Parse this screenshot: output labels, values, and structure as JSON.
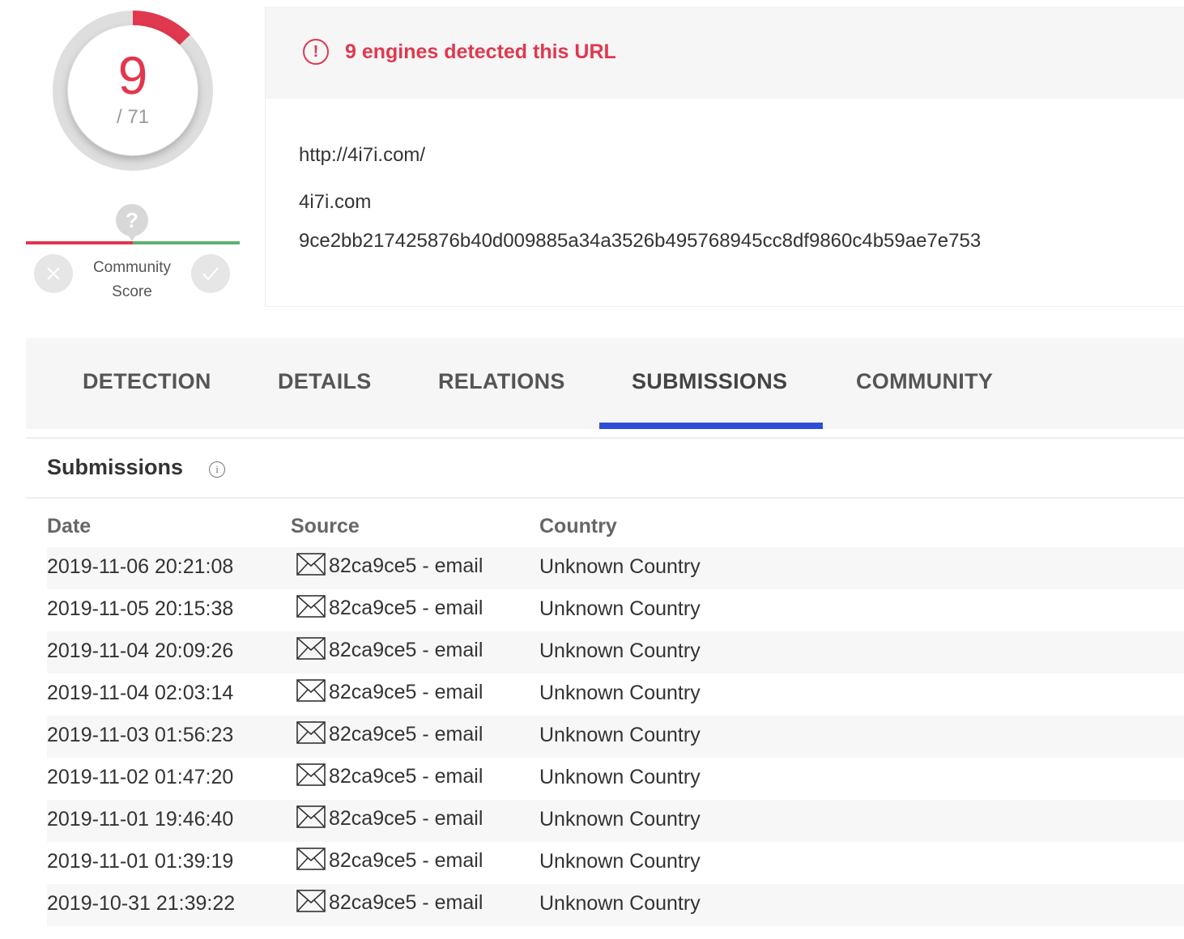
{
  "score": {
    "detected": "9",
    "total": "/ 71",
    "ratio": 0.1268,
    "accent_color": "#e0384f",
    "community_label_line1": "Community",
    "community_label_line2": "Score",
    "community_marker": "?",
    "community_score": 0
  },
  "alert": {
    "text": "9 engines detected this URL",
    "icon": "exclamation-circle-icon"
  },
  "target": {
    "url": "http://4i7i.com/",
    "domain": "4i7i.com",
    "hash": "9ce2bb217425876b40d009885a34a3526b495768945cc8df9860c4b59ae7e753"
  },
  "tabs": [
    {
      "label": "DETECTION"
    },
    {
      "label": "DETAILS"
    },
    {
      "label": "RELATIONS"
    },
    {
      "label": "SUBMISSIONS",
      "active": true
    },
    {
      "label": "COMMUNITY"
    }
  ],
  "tab_accent_color": "#2f4ed8",
  "submissions": {
    "title": "Submissions",
    "columns": {
      "date": "Date",
      "source": "Source",
      "country": "Country"
    },
    "rows": [
      {
        "date": "2019-11-06 20:21:08",
        "source": "82ca9ce5 - email",
        "country": "Unknown Country"
      },
      {
        "date": "2019-11-05 20:15:38",
        "source": "82ca9ce5 - email",
        "country": "Unknown Country"
      },
      {
        "date": "2019-11-04 20:09:26",
        "source": "82ca9ce5 - email",
        "country": "Unknown Country"
      },
      {
        "date": "2019-11-04 02:03:14",
        "source": "82ca9ce5 - email",
        "country": "Unknown Country"
      },
      {
        "date": "2019-11-03 01:56:23",
        "source": "82ca9ce5 - email",
        "country": "Unknown Country"
      },
      {
        "date": "2019-11-02 01:47:20",
        "source": "82ca9ce5 - email",
        "country": "Unknown Country"
      },
      {
        "date": "2019-11-01 19:46:40",
        "source": "82ca9ce5 - email",
        "country": "Unknown Country"
      },
      {
        "date": "2019-11-01 01:39:19",
        "source": "82ca9ce5 - email",
        "country": "Unknown Country"
      },
      {
        "date": "2019-10-31 21:39:22",
        "source": "82ca9ce5 - email",
        "country": "Unknown Country"
      }
    ]
  }
}
